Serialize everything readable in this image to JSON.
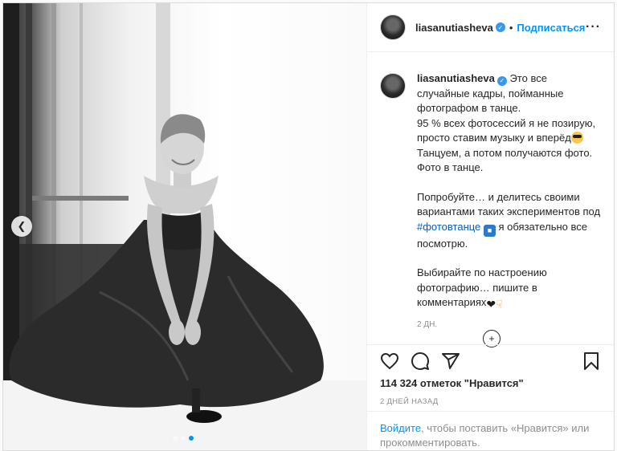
{
  "post": {
    "username": "liasanutiasheva",
    "separator": "•",
    "follow_label": "Подписаться",
    "more_label": "···",
    "caption_lines": [
      "Это все случайные",
      "кадры, пойманные фотографом в",
      "танце.",
      "95 % всех фотосессий я не позирую,",
      "просто ставим музыку и вперёд",
      "Танцуем, а потом получаются фото.",
      "Фото в танце."
    ],
    "caption_p2_prefix": "Попробуйте… и делитесь своими вариантами таких экспериментов под ",
    "hashtag": "#фотовтанце",
    "caption_p2_suffix": " я обязательно все посмотрю.",
    "caption_p3": "Выбирайте по настроению фотографию… пишите в комментариях",
    "time_ago": "2 дн.",
    "likes": "114 324 отметок \"Нравится\"",
    "date": "2 ДНЕЙ НАЗАД",
    "login_link": "Войдите",
    "login_text": ", чтобы поставить «Нравится» или прокомментировать."
  },
  "icons": {
    "prev": "chevron-left-icon",
    "like": "heart-icon",
    "comment": "comment-icon",
    "share": "paper-plane-icon",
    "save": "bookmark-icon",
    "load_more": "plus-circle-icon"
  },
  "carousel": {
    "slide_count": 3,
    "active_slide": 3
  },
  "colors": {
    "accent": "#0095f6",
    "verified": "#3897f0",
    "muted": "#8e8e8e"
  }
}
